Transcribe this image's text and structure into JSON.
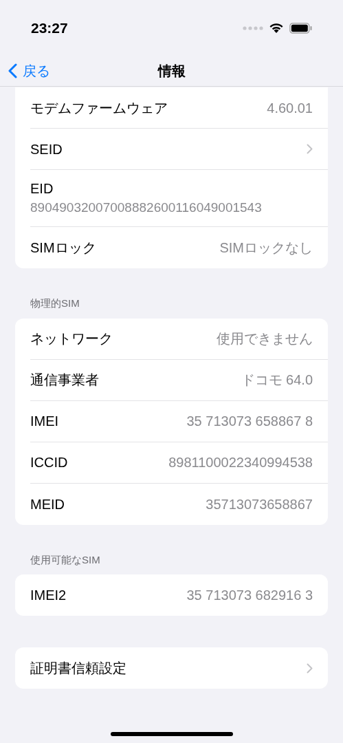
{
  "status_bar": {
    "time": "23:27"
  },
  "nav": {
    "back": "戻る",
    "title": "情報"
  },
  "sections": [
    {
      "rows": [
        {
          "kind": "value",
          "label": "モデムファームウェア",
          "value": "4.60.01"
        },
        {
          "kind": "chevron",
          "label": "SEID"
        },
        {
          "kind": "stacked",
          "label": "EID",
          "value": "89049032007008882600116049001543"
        },
        {
          "kind": "value",
          "label": "SIMロック",
          "value": "SIMロックなし"
        }
      ]
    },
    {
      "header": "物理的SIM",
      "rows": [
        {
          "kind": "value",
          "label": "ネットワーク",
          "value": "使用できません"
        },
        {
          "kind": "value",
          "label": "通信事業者",
          "value": "ドコモ 64.0"
        },
        {
          "kind": "value",
          "label": "IMEI",
          "value": "35 713073 658867 8"
        },
        {
          "kind": "value",
          "label": "ICCID",
          "value": "8981100022340994538"
        },
        {
          "kind": "value",
          "label": "MEID",
          "value": "35713073658867"
        }
      ]
    },
    {
      "header": "使用可能なSIM",
      "rows": [
        {
          "kind": "value",
          "label": "IMEI2",
          "value": "35 713073 682916 3"
        }
      ]
    },
    {
      "rows": [
        {
          "kind": "chevron",
          "label": "証明書信頼設定"
        }
      ]
    }
  ]
}
